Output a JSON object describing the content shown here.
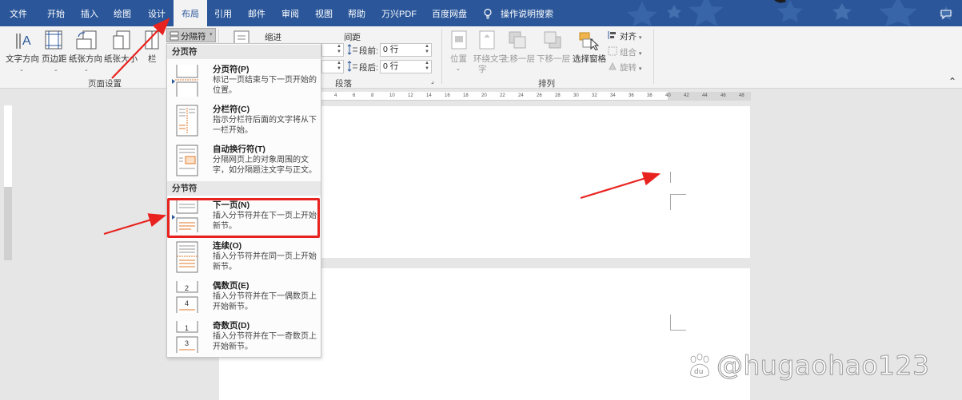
{
  "tabs": [
    "文件",
    "开始",
    "插入",
    "绘图",
    "设计",
    "布局",
    "引用",
    "邮件",
    "审阅",
    "视图",
    "帮助",
    "万兴PDF",
    "百度网盘"
  ],
  "active_tab": "布局",
  "tell_me": "操作说明搜索",
  "ribbon": {
    "page_setup": {
      "buttons": [
        "文字方向",
        "页边距",
        "纸张方向",
        "纸张大小",
        "栏"
      ],
      "breaks_label": "分隔符",
      "group_label": "页面设置"
    },
    "paragraph": {
      "indent_label": "缩进",
      "spacing_label": "间距",
      "before_label": "段前:",
      "before_value": "0 行",
      "after_label": "段后:",
      "after_value": "0 行",
      "group_label": "段落"
    },
    "arrange": {
      "buttons": [
        "位置",
        "环绕文字",
        "上移一层",
        "下移一层",
        "选择窗格"
      ],
      "wrap_text_line2": "字",
      "small": [
        "对齐",
        "组合",
        "旋转"
      ],
      "group_label": "排列"
    }
  },
  "dropdown": {
    "page_breaks_header": "分页符",
    "section_breaks_header": "分节符",
    "page_breaks": [
      {
        "title": "分页符(P)",
        "desc": "标记一页结束与下一页开始的位置。"
      },
      {
        "title": "分栏符(C)",
        "desc": "指示分栏符后面的文字将从下一栏开始。"
      },
      {
        "title": "自动换行符(T)",
        "desc": "分隔网页上的对象周围的文字，如分隔题注文字与正文。"
      }
    ],
    "section_breaks": [
      {
        "title": "下一页(N)",
        "desc": "插入分节符并在下一页上开始新节。"
      },
      {
        "title": "连续(O)",
        "desc": "插入分节符并在同一页上开始新节。"
      },
      {
        "title": "偶数页(E)",
        "desc": "插入分节符并在下一偶数页上开始新节。"
      },
      {
        "title": "奇数页(D)",
        "desc": "插入分节符并在下一奇数页上开始新节。"
      }
    ],
    "even_icon_nums": [
      "2",
      "4"
    ],
    "odd_icon_nums": [
      "1",
      "3"
    ]
  },
  "ruler_labels": [
    "4",
    "6",
    "8",
    "10",
    "12",
    "14",
    "16",
    "18",
    "20",
    "22",
    "24",
    "26",
    "28",
    "30",
    "32",
    "34",
    "36",
    "38",
    "40",
    "42",
    "44",
    "46",
    "48"
  ],
  "watermark": "@hugaohao123",
  "watermark_logo": "du",
  "colors": {
    "accent": "#2b579a",
    "highlight": "#e8231f",
    "icon_orange": "#e07a2e"
  }
}
